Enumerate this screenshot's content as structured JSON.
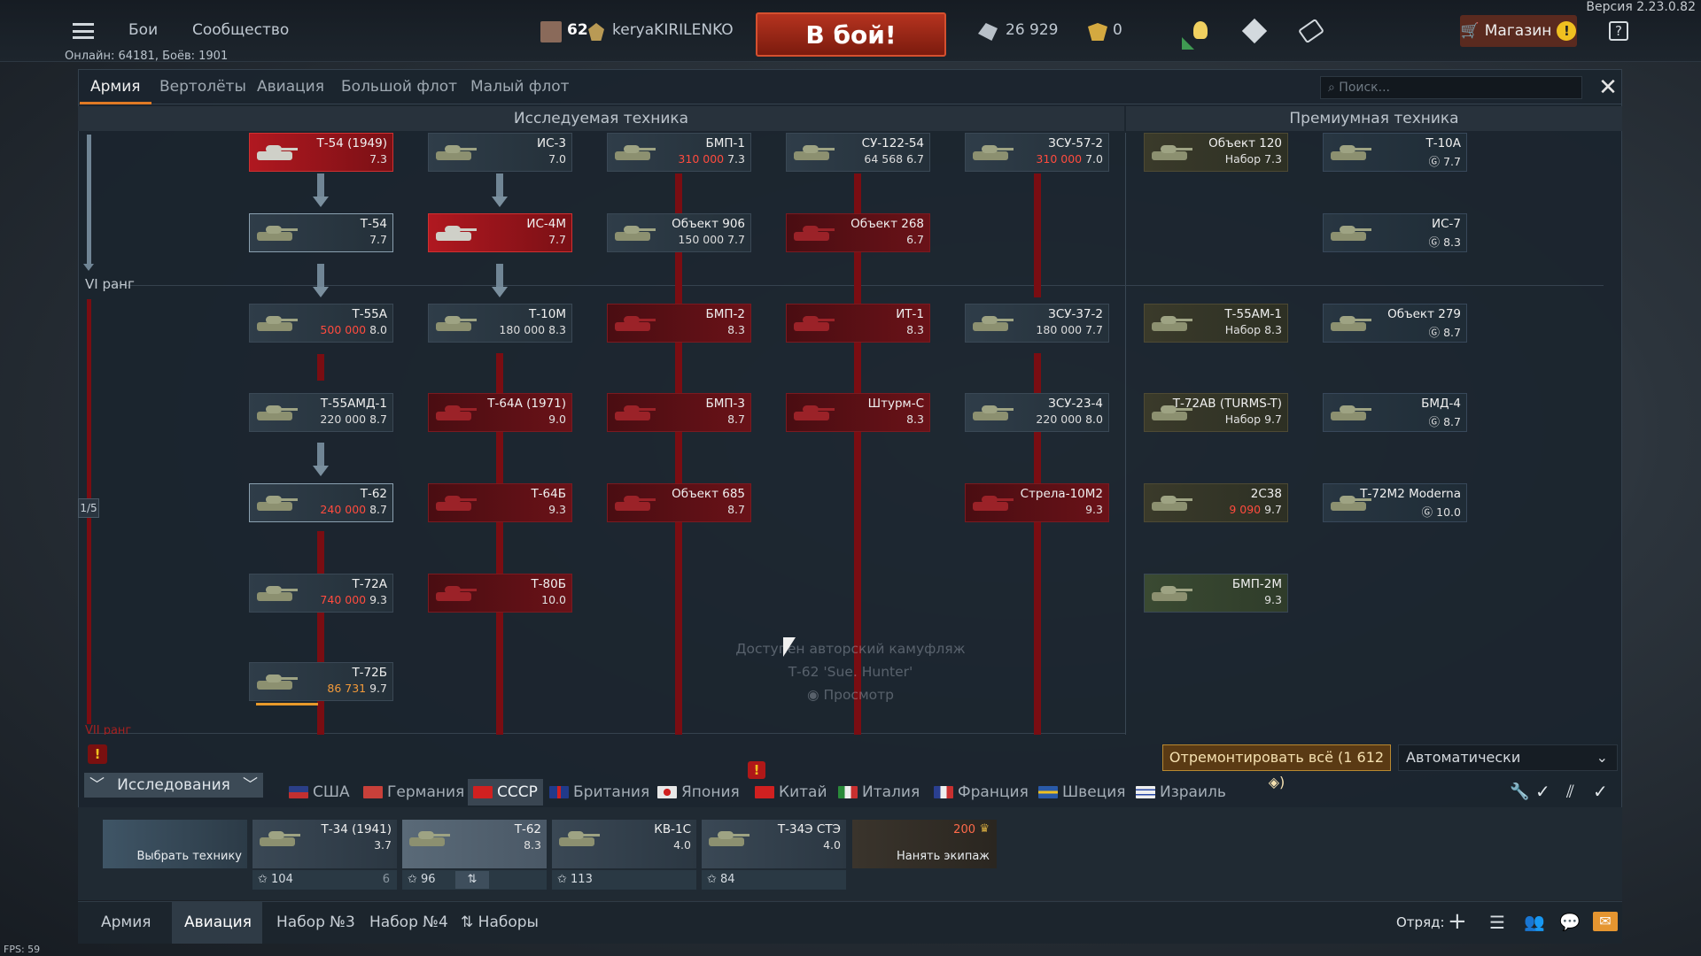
{
  "version": "Версия 2.23.0.82",
  "online": "Онлайн: 64181, Боёв: 1901",
  "menu": {
    "battles": "Бои",
    "community": "Сообщество"
  },
  "player": {
    "level": "62",
    "name": "keryaKIRILENKO"
  },
  "battle_button": "В бой!",
  "currency": {
    "silver": "26 929",
    "gold": "0"
  },
  "shop": {
    "label": "Магазин",
    "warn": "!"
  },
  "help": "?",
  "tabs": [
    "Армия",
    "Вертолёты",
    "Авиация",
    "Большой флот",
    "Малый флот"
  ],
  "search_placeholder": "Поиск...",
  "close": "✕",
  "sections": {
    "research": "Исследуемая техника",
    "premium": "Премиумная техника"
  },
  "ranks": {
    "r6": "VI ранг",
    "r7": "VII ранг",
    "counter": "1/5"
  },
  "vehicles": {
    "t54_1949": {
      "name": "Т-54 (1949)",
      "br": "7.3"
    },
    "is3": {
      "name": "ИС-3",
      "br": "7.0"
    },
    "bmp1": {
      "name": "БМП-1",
      "cost": "310 000",
      "br": "7.3"
    },
    "su122": {
      "name": "СУ-122-54",
      "cost": "64 568",
      "br": "6.7"
    },
    "zsu572": {
      "name": "ЗСУ-57-2",
      "cost": "310 000",
      "br": "7.0"
    },
    "obj120": {
      "name": "Объект 120",
      "cost": "Набор",
      "br": "7.3"
    },
    "t10a": {
      "name": "Т-10А",
      "br": "7.7"
    },
    "t54": {
      "name": "Т-54",
      "br": "7.7"
    },
    "is4m": {
      "name": "ИС-4М",
      "br": "7.7"
    },
    "obj906": {
      "name": "Объект 906",
      "cost": "150 000",
      "br": "7.7"
    },
    "obj268": {
      "name": "Объект 268",
      "br": "6.7"
    },
    "is7": {
      "name": "ИС-7",
      "br": "8.3"
    },
    "t55a": {
      "name": "Т-55А",
      "cost": "500 000",
      "br": "8.0"
    },
    "t10m": {
      "name": "Т-10М",
      "cost": "180 000",
      "br": "8.3"
    },
    "bmp2": {
      "name": "БМП-2",
      "br": "8.3"
    },
    "it1": {
      "name": "ИТ-1",
      "br": "8.3"
    },
    "zsu37": {
      "name": "ЗСУ-37-2",
      "cost": "180 000",
      "br": "7.7"
    },
    "t55am1": {
      "name": "Т-55АМ-1",
      "cost": "Набор",
      "br": "8.3"
    },
    "obj279": {
      "name": "Объект 279",
      "br": "8.7"
    },
    "t55amd": {
      "name": "Т-55АМД-1",
      "cost": "220 000",
      "br": "8.7"
    },
    "t64a": {
      "name": "Т-64А (1971)",
      "br": "9.0"
    },
    "bmp3": {
      "name": "БМП-3",
      "br": "8.7"
    },
    "shturm": {
      "name": "Штурм-С",
      "br": "8.3"
    },
    "zsu23": {
      "name": "ЗСУ-23-4",
      "cost": "220 000",
      "br": "8.0"
    },
    "t72av": {
      "name": "Т-72АВ (TURMS-T)",
      "cost": "Набор",
      "br": "9.7"
    },
    "bmd4": {
      "name": "БМД-4",
      "br": "8.7"
    },
    "t62": {
      "name": "Т-62",
      "cost": "240 000",
      "br": "8.7"
    },
    "t64b": {
      "name": "Т-64Б",
      "br": "9.3"
    },
    "obj685": {
      "name": "Объект 685",
      "br": "8.7"
    },
    "strela": {
      "name": "Стрела-10М2",
      "br": "9.3"
    },
    "2s38": {
      "name": "2С38",
      "cost": "9 090",
      "br": "9.7"
    },
    "t72m2": {
      "name": "Т-72М2 Moderna",
      "br": "10.0"
    },
    "t72a": {
      "name": "Т-72А",
      "cost": "740 000",
      "br": "9.3"
    },
    "t80b": {
      "name": "Т-80Б",
      "br": "10.0"
    },
    "bmp2m": {
      "name": "БМП-2М",
      "br": "9.3"
    },
    "t72b": {
      "name": "Т-72Б",
      "cost": "86 731",
      "br": "9.7"
    }
  },
  "camo": {
    "line1": "Доступен авторский камуфляж",
    "line2": "Т-62 'Sue. Hunter'",
    "line3": "Просмотр"
  },
  "repair": {
    "label": "Отремонтировать всё (1 612",
    "icon": "silver-lion-icon"
  },
  "auto_select": "Автоматически",
  "research_label": "Исследования",
  "nations": [
    {
      "name": "США",
      "flag": "flag-usa"
    },
    {
      "name": "Германия",
      "flag": "flag-germany"
    },
    {
      "name": "СССР",
      "flag": "flag-ussr"
    },
    {
      "name": "Британия",
      "flag": "flag-britain"
    },
    {
      "name": "Япония",
      "flag": "flag-japan"
    },
    {
      "name": "Китай",
      "flag": "flag-china"
    },
    {
      "name": "Италия",
      "flag": "flag-italy"
    },
    {
      "name": "Франция",
      "flag": "flag-france"
    },
    {
      "name": "Швеция",
      "flag": "flag-sweden"
    },
    {
      "name": "Израиль",
      "flag": "flag-israel"
    }
  ],
  "crew": {
    "select": "Выбрать технику",
    "slots": [
      {
        "name": "Т-34 (1941)",
        "br": "3.7",
        "count": "104",
        "extra": "6"
      },
      {
        "name": "Т-62",
        "br": "8.3",
        "count": "96",
        "extra": ""
      },
      {
        "name": "КВ-1С",
        "br": "4.0",
        "count": "113",
        "extra": ""
      },
      {
        "name": "Т-34Э СТЭ",
        "br": "4.0",
        "count": "84",
        "extra": ""
      }
    ],
    "hire_cost": "200",
    "hire": "Нанять экипаж"
  },
  "bottom_tabs": [
    "Армия",
    "Авиация",
    "Набор №3",
    "Набор №4",
    "Наборы"
  ],
  "squad": "Отряд:",
  "fps": "FPS: 59",
  "colors": {
    "accent": "#e07a25",
    "battle": "#b5331f",
    "locked": "#7a0d12",
    "cost": "#ff4b3e"
  }
}
